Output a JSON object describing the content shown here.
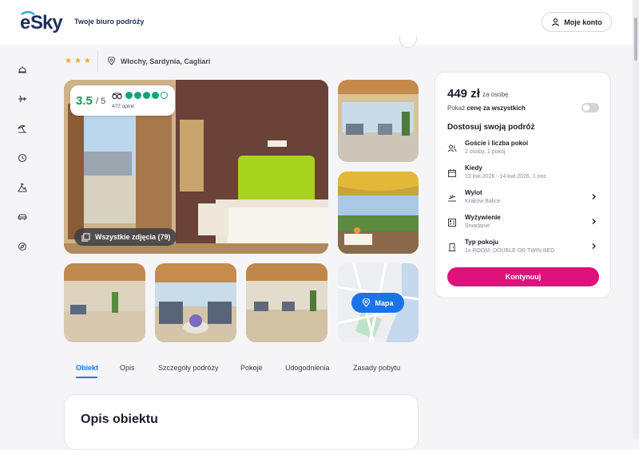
{
  "header": {
    "logo_text": "eSky",
    "tagline": "Twoje biuro podróży",
    "account_label": "Moje konto"
  },
  "sidebar": {
    "items": [
      {
        "icon": "hotel-bell-icon"
      },
      {
        "icon": "plane-icon"
      },
      {
        "icon": "beach-umbrella-icon"
      },
      {
        "icon": "clock-icon"
      },
      {
        "icon": "mountain-flag-icon"
      },
      {
        "icon": "car-icon"
      },
      {
        "icon": "compass-icon"
      }
    ]
  },
  "hotel": {
    "stars": "★★★",
    "location": "Włochy, Sardynia, Cagliari"
  },
  "rating": {
    "score": "3.5",
    "max": "/ 5",
    "bubbles_filled": 4,
    "bubbles_total": 5,
    "reviews": "477 opinii"
  },
  "gallery": {
    "all_photos_label": "Wszystkie zdjęcia (79)",
    "map_label": "Mapa"
  },
  "tabs": [
    {
      "label": "Obiekt",
      "active": true
    },
    {
      "label": "Opis"
    },
    {
      "label": "Szczegóły podróży"
    },
    {
      "label": "Pokoje"
    },
    {
      "label": "Udogodnienia"
    },
    {
      "label": "Zasady pobytu"
    }
  ],
  "description": {
    "title": "Opis obiektu"
  },
  "booking": {
    "price": "449 zł",
    "per_person": "za osobę",
    "toggle_prefix": "Pokaż ",
    "toggle_bold": "cenę za wszystkich",
    "toggle_on": false,
    "title": "Dostosuj swoją podróż",
    "options": [
      {
        "label": "Goście i liczba pokoi",
        "value": "2 osoby, 1 pokój",
        "icon": "guests-icon",
        "chevron": false
      },
      {
        "label": "Kiedy",
        "value": "13 kwi 2026 - 14 kwi 2026, 1 noc",
        "icon": "calendar-icon",
        "chevron": false
      },
      {
        "label": "Wylot",
        "value": "Kraków Balice",
        "icon": "departure-icon",
        "chevron": true
      },
      {
        "label": "Wyżywienie",
        "value": "Śniadanie",
        "icon": "meal-icon",
        "chevron": true
      },
      {
        "label": "Typ pokoju",
        "value": "1x ROOM, DOUBLE OR TWIN BED",
        "icon": "door-icon",
        "chevron": true
      }
    ],
    "continue_label": "Kontynuuj"
  },
  "colors": {
    "accent": "#e0117a",
    "link": "#1a73e8",
    "rating": "#0f9d58",
    "stars": "#f0a82a"
  }
}
